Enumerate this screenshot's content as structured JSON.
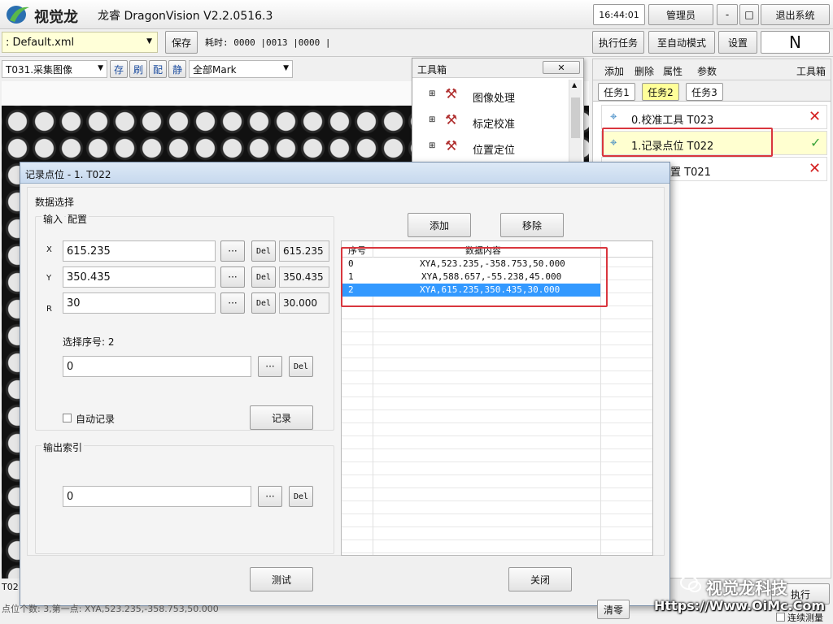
{
  "titlebar": {
    "brand": "视觉龙",
    "title": "龙睿 DragonVision V2.2.0516.3",
    "clock": "16:44:01",
    "user": "管理员",
    "minimize": "-",
    "maximize": "□",
    "exit": "退出系统"
  },
  "toolbar": {
    "file": ": Default.xml",
    "save": "保存",
    "timing": "耗时: 0000 |0013 |0000 |",
    "run_task": "执行任务",
    "auto_mode": "至自动模式",
    "settings": "设置",
    "mode_letter": "N"
  },
  "imagebar": {
    "camera_select": "T031.采集图像",
    "b_save": "存",
    "b_refresh": "刷",
    "b_config": "配",
    "b_static": "静",
    "mark_select": "全部Mark"
  },
  "toolbox": {
    "title": "工具箱",
    "items": [
      "图像处理",
      "标定校准",
      "位置定位"
    ]
  },
  "rightpanel": {
    "actions": [
      "添加",
      "删除",
      "属性",
      "参数"
    ],
    "header": "工具箱",
    "tabs": [
      "任务1",
      "任务2",
      "任务3"
    ],
    "tasks": [
      {
        "label": "0.校准工具 T023",
        "status": "fail"
      },
      {
        "label": "1.记录点位 T022",
        "status": "ok"
      },
      {
        "label": "置 T021",
        "status": "fail"
      }
    ]
  },
  "dialog": {
    "title": "记录点位 - 1. T022",
    "data_select": "数据选择",
    "input_tab": "输入",
    "config_tab": "配置",
    "x_label": "X",
    "y_label": "Y",
    "r_label": "R",
    "x_value": "615.235",
    "y_value": "350.435",
    "r_value": "30",
    "x_read": "615.235",
    "y_read": "350.435",
    "r_read": "30.000",
    "dots": "···",
    "del": "Del",
    "select_index": "选择序号: 2",
    "index_value": "0",
    "auto_record": "自动记录",
    "record": "记录",
    "output_index": "输出索引",
    "output_value": "0",
    "add": "添加",
    "remove": "移除",
    "table": {
      "headers": [
        "序号",
        "数据内容"
      ],
      "rows": [
        {
          "idx": "0",
          "content": "XYA,523.235,-358.753,50.000"
        },
        {
          "idx": "1",
          "content": "XYA,588.657,-55.238,45.000"
        },
        {
          "idx": "2",
          "content": "XYA,615.235,350.435,30.000"
        }
      ]
    },
    "test": "测试",
    "close": "关闭"
  },
  "statusbar": {
    "tool_code": "T02",
    "point_info": "点位个数: 3,第一点: XYA,523.235,-358.753,50.000",
    "clear": "清零",
    "execute": "执行",
    "continuous": "连续测量"
  },
  "watermark": {
    "name": "视觉龙科技",
    "url": "Https://Www.OiMc.Com"
  },
  "colors": {
    "selection": "#3399ff",
    "highlight_red": "#d9363e",
    "active_tab": "#ffff99",
    "ok_green": "#3aa33a",
    "fail_red": "#d42020"
  }
}
